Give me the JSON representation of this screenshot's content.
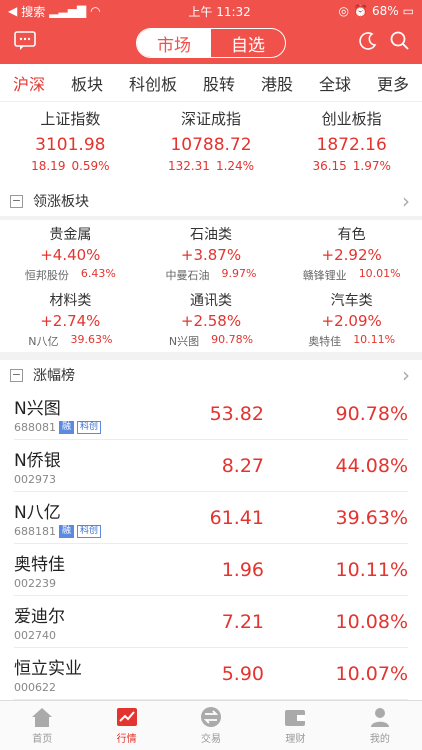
{
  "status": {
    "carrier": "搜索",
    "time": "上午 11:32",
    "battery": "68%"
  },
  "header": {
    "seg_market": "市场",
    "seg_watch": "自选"
  },
  "tabs": [
    "沪深",
    "板块",
    "科创板",
    "股转",
    "港股",
    "全球",
    "更多"
  ],
  "indices": [
    {
      "name": "上证指数",
      "value": "3101.98",
      "chg": "18.19",
      "pct": "0.59%"
    },
    {
      "name": "深证成指",
      "value": "10788.72",
      "chg": "132.31",
      "pct": "1.24%"
    },
    {
      "name": "创业板指",
      "value": "1872.16",
      "chg": "36.15",
      "pct": "1.97%"
    }
  ],
  "leading": {
    "title": "领涨板块",
    "items": [
      {
        "name": "贵金属",
        "pct": "+4.40%",
        "stock": "恒邦股份",
        "spct": "6.43%"
      },
      {
        "name": "石油类",
        "pct": "+3.87%",
        "stock": "中曼石油",
        "spct": "9.97%"
      },
      {
        "name": "有色",
        "pct": "+2.92%",
        "stock": "赣锋锂业",
        "spct": "10.01%"
      },
      {
        "name": "材料类",
        "pct": "+2.74%",
        "stock": "N八亿",
        "spct": "39.63%"
      },
      {
        "name": "通讯类",
        "pct": "+2.58%",
        "stock": "N兴图",
        "spct": "90.78%"
      },
      {
        "name": "汽车类",
        "pct": "+2.09%",
        "stock": "奥特佳",
        "spct": "10.11%"
      }
    ]
  },
  "gainers": {
    "title": "涨幅榜",
    "rows": [
      {
        "name": "N兴图",
        "code": "688081",
        "tags": [
          "融",
          "科创"
        ],
        "price": "53.82",
        "pct": "90.78%"
      },
      {
        "name": "N侨银",
        "code": "002973",
        "tags": [],
        "price": "8.27",
        "pct": "44.08%"
      },
      {
        "name": "N八亿",
        "code": "688181",
        "tags": [
          "融",
          "科创"
        ],
        "price": "61.41",
        "pct": "39.63%"
      },
      {
        "name": "奥特佳",
        "code": "002239",
        "tags": [],
        "price": "1.96",
        "pct": "10.11%"
      },
      {
        "name": "爱迪尔",
        "code": "002740",
        "tags": [],
        "price": "7.21",
        "pct": "10.08%"
      },
      {
        "name": "恒立实业",
        "code": "000622",
        "tags": [],
        "price": "5.90",
        "pct": "10.07%"
      }
    ]
  },
  "tabbar": [
    "首页",
    "行情",
    "交易",
    "理财",
    "我的"
  ]
}
